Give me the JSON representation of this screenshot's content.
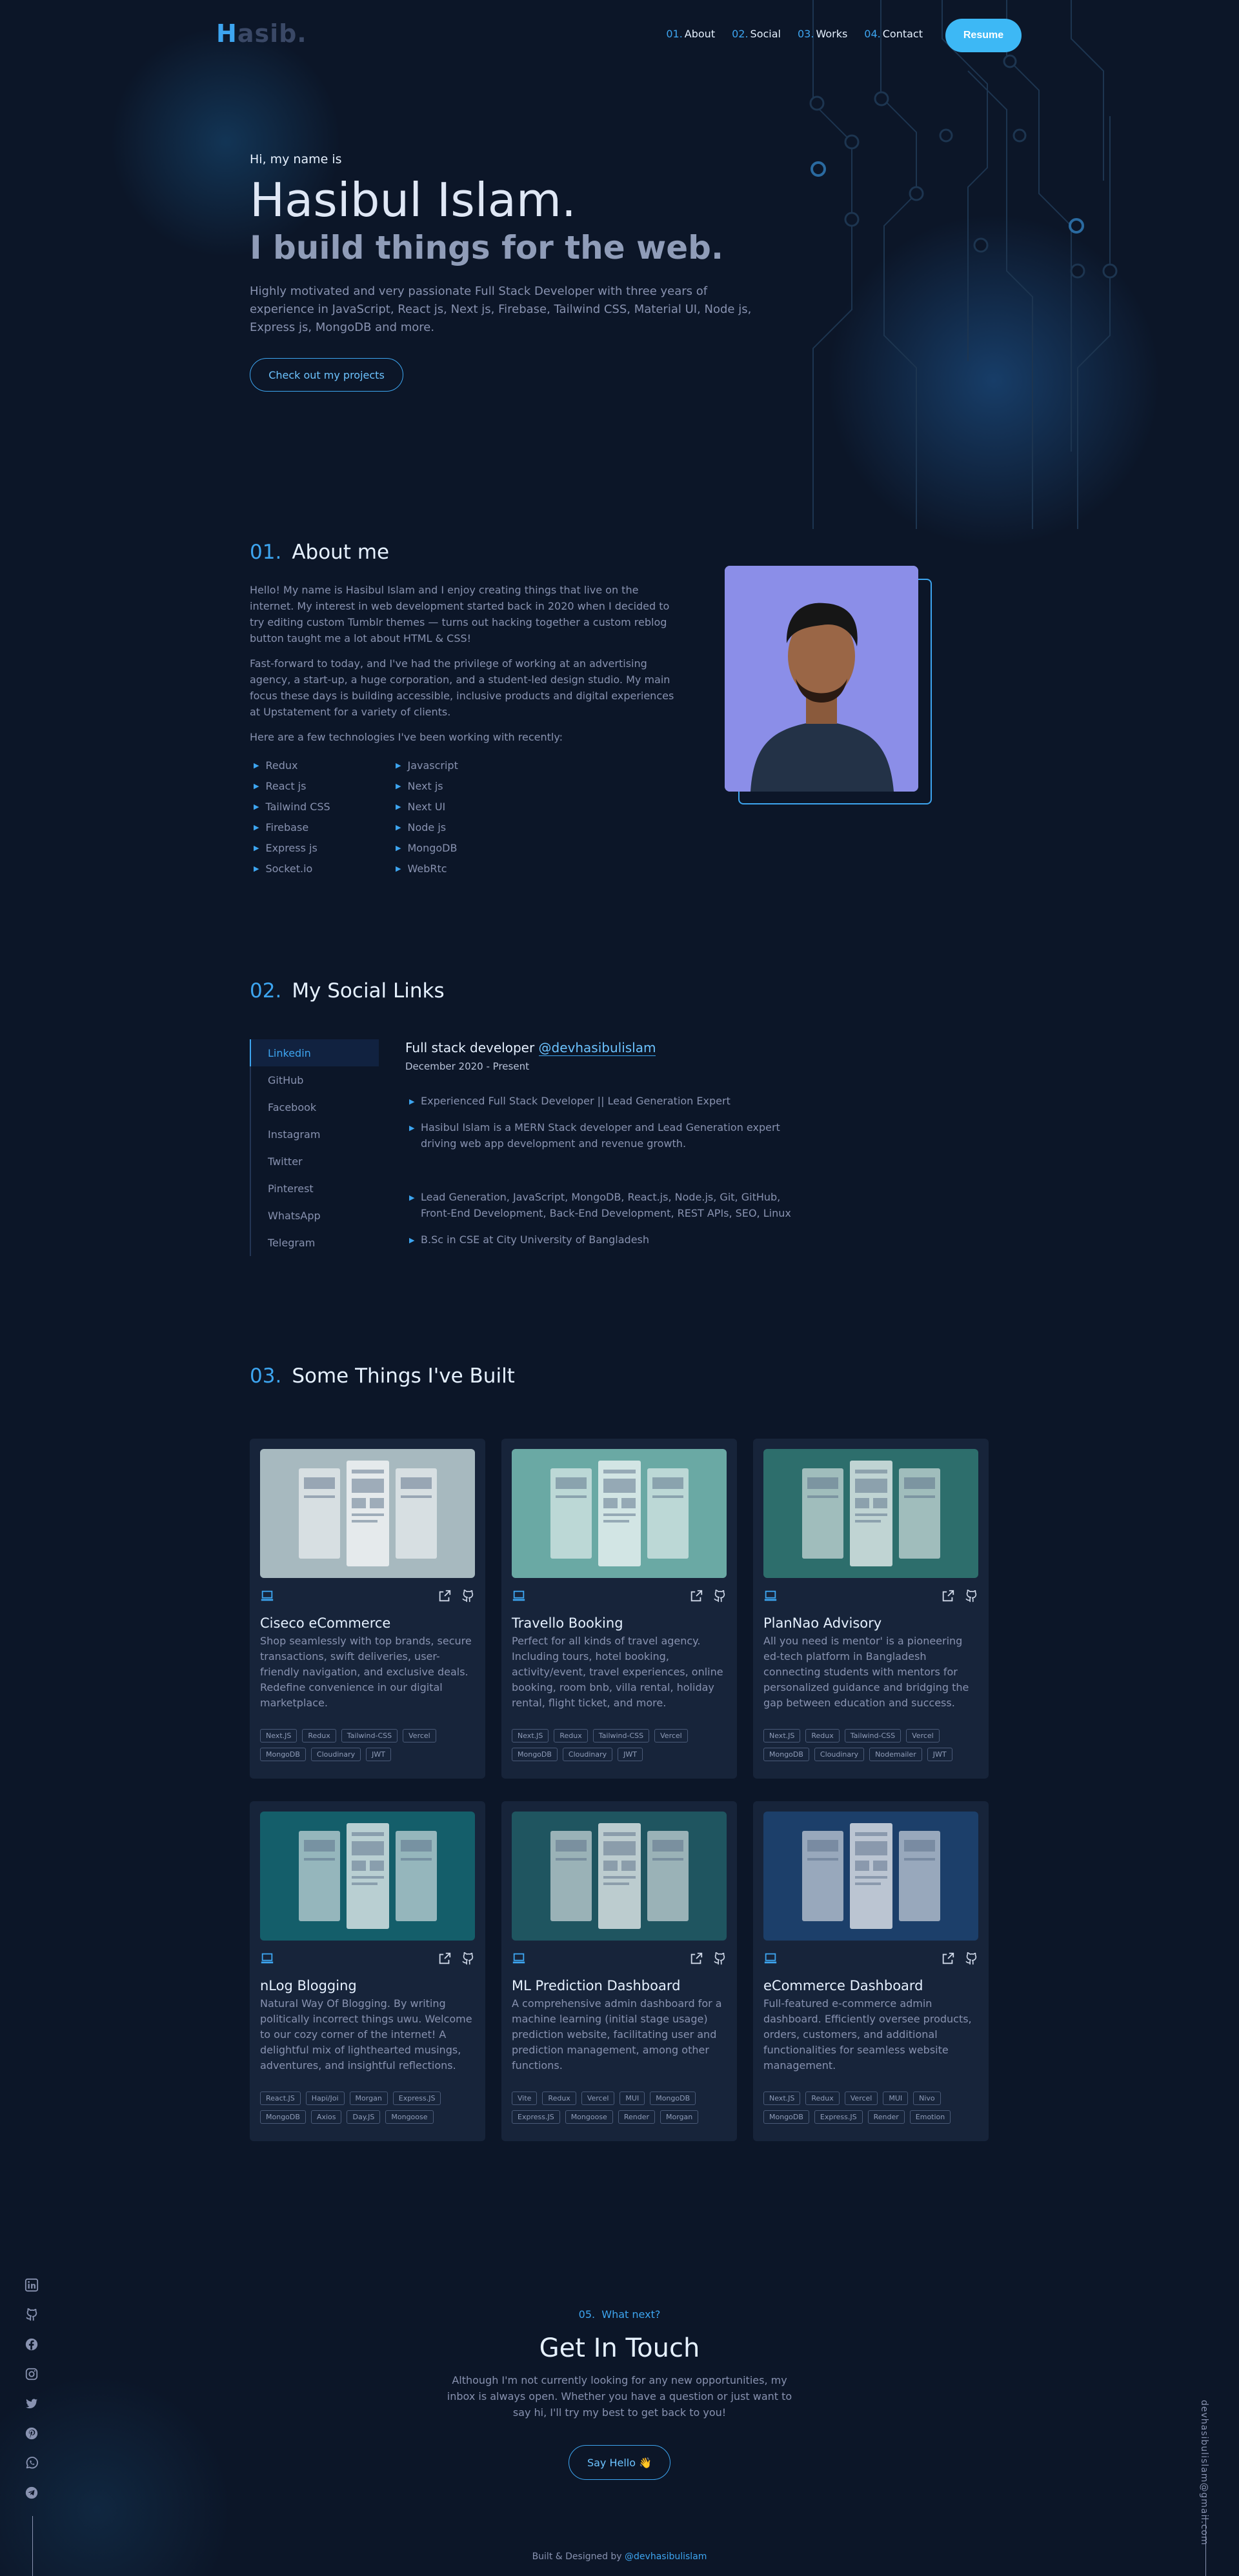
{
  "nav": {
    "logo_first": "H",
    "logo_rest": "asib.",
    "links": [
      {
        "num": "01.",
        "label": "About"
      },
      {
        "num": "02.",
        "label": "Social"
      },
      {
        "num": "03.",
        "label": "Works"
      },
      {
        "num": "04.",
        "label": "Contact"
      }
    ],
    "resume_label": "Resume"
  },
  "hero": {
    "greeting": "Hi, my name is",
    "name": "Hasibul Islam.",
    "tagline": "I build things for the web.",
    "description": "Highly motivated and very passionate Full Stack Developer with three years of experience in JavaScript, React js, Next js, Firebase, Tailwind CSS, Material UI, Node js, Express js, MongoDB and more.",
    "cta_label": "Check out my projects"
  },
  "about": {
    "num": "01.",
    "title": "About me",
    "paragraphs": [
      "Hello! My name is Hasibul Islam and I enjoy creating things that live on the internet. My interest in web development started back in 2020 when I decided to try editing custom Tumblr themes — turns out hacking together a custom reblog button taught me a lot about HTML & CSS!",
      "Fast-forward to today, and I've had the privilege of working at an advertising agency, a start-up, a huge corporation, and a student-led design studio. My main focus these days is building accessible, inclusive products and digital experiences at Upstatement for a variety of clients.",
      "Here are a few technologies I've been working with recently:"
    ],
    "technologies": [
      "Redux",
      "React js",
      "Tailwind CSS",
      "Firebase",
      "Express js",
      "Socket.io",
      "Javascript",
      "Next js",
      "Next UI",
      "Node js",
      "MongoDB",
      "WebRtc"
    ]
  },
  "social": {
    "num": "02.",
    "title": "My Social Links",
    "tabs": [
      "Linkedin",
      "GitHub",
      "Facebook",
      "Instagram",
      "Twitter",
      "Pinterest",
      "WhatsApp",
      "Telegram"
    ],
    "active_tab": "Linkedin",
    "job_title": "Full stack developer",
    "job_handle": "@devhasibulislam",
    "job_date": "December 2020 - Present",
    "bullets": [
      "Experienced Full Stack Developer || Lead Generation Expert",
      "Hasibul Islam is a MERN Stack developer and Lead Generation expert driving web app development and revenue growth.",
      "Lead Generation, JavaScript, MongoDB, React.js, Node.js, Git, GitHub, Front-End Development, Back-End Development, REST APIs, SEO, Linux",
      "B.Sc in CSE at City University of Bangladesh"
    ]
  },
  "projects": {
    "num": "03.",
    "title": "Some Things I've Built",
    "items": [
      {
        "title": "Ciseco eCommerce",
        "description": "Shop seamlessly with top brands, secure transactions, swift deliveries, user-friendly navigation, and exclusive deals. Redefine convenience in our digital marketplace.",
        "tags": [
          "Next.JS",
          "Redux",
          "Tailwind-CSS",
          "Vercel",
          "MongoDB",
          "Cloudinary",
          "JWT"
        ],
        "bg": "#a7b9bf"
      },
      {
        "title": "Travello Booking",
        "description": "Perfect for all kinds of travel agency. Including tours, hotel booking, activity/event, travel experiences, online booking, room bnb, villa rental, holiday rental, flight ticket, and more.",
        "tags": [
          "Next.JS",
          "Redux",
          "Tailwind-CSS",
          "Vercel",
          "MongoDB",
          "Cloudinary",
          "JWT"
        ],
        "bg": "#6aa9a4"
      },
      {
        "title": "PlanNao Advisory",
        "description": "All you need is mentor' is a pioneering ed-tech platform in Bangladesh connecting students with mentors for personalized guidance and bridging the gap between education and success.",
        "tags": [
          "Next.JS",
          "Redux",
          "Tailwind-CSS",
          "Vercel",
          "MongoDB",
          "Cloudinary",
          "Nodemailer",
          "JWT"
        ],
        "bg": "#2d6e6c"
      },
      {
        "title": "nLog Blogging",
        "description": "Natural Way Of Blogging. By writing politically incorrect things uwu. Welcome to our cozy corner of the internet! A delightful mix of lighthearted musings, adventures, and insightful reflections.",
        "tags": [
          "React.JS",
          "Hapi/Joi",
          "Morgan",
          "Express.JS",
          "MongoDB",
          "Axios",
          "Day.JS",
          "Mongoose"
        ],
        "bg": "#145e6a"
      },
      {
        "title": "ML Prediction Dashboard",
        "description": "A comprehensive admin dashboard for a machine learning (initial stage usage) prediction website, facilitating user and prediction management, among other functions.",
        "tags": [
          "Vite",
          "Redux",
          "Vercel",
          "MUI",
          "MongoDB",
          "Express.JS",
          "Mongoose",
          "Render",
          "Morgan"
        ],
        "bg": "#1f5560"
      },
      {
        "title": "eCommerce Dashboard",
        "description": "Full-featured e-commerce admin dashboard. Efficiently oversee products, orders, customers, and additional functionalities for seamless website management.",
        "tags": [
          "Next.JS",
          "Redux",
          "Vercel",
          "MUI",
          "Nivo",
          "MongoDB",
          "Express.JS",
          "Render",
          "Emotion"
        ],
        "bg": "#1c3f6a"
      }
    ]
  },
  "contact": {
    "num": "05.",
    "label": "What next?",
    "title": "Get In Touch",
    "description": "Although I'm not currently looking for any new opportunities, my inbox is always open. Whether you have a question or just want to say hi, I'll try my best to get back to you!",
    "button_label": "Say Hello 👋"
  },
  "side": {
    "icons": [
      "linkedin-icon",
      "github-icon",
      "facebook-icon",
      "instagram-icon",
      "twitter-icon",
      "pinterest-icon",
      "whatsapp-icon",
      "telegram-icon"
    ],
    "email": "devhasibulislam@gmail.com"
  },
  "footer": {
    "prefix": "Built & Designed by ",
    "handle": "@devhasibulislam"
  },
  "colors": {
    "background": "#0c1628",
    "accent": "#3da5f0",
    "heading": "#e6f1ff",
    "body_text": "#8892b0",
    "card_bg": "#17243a"
  }
}
